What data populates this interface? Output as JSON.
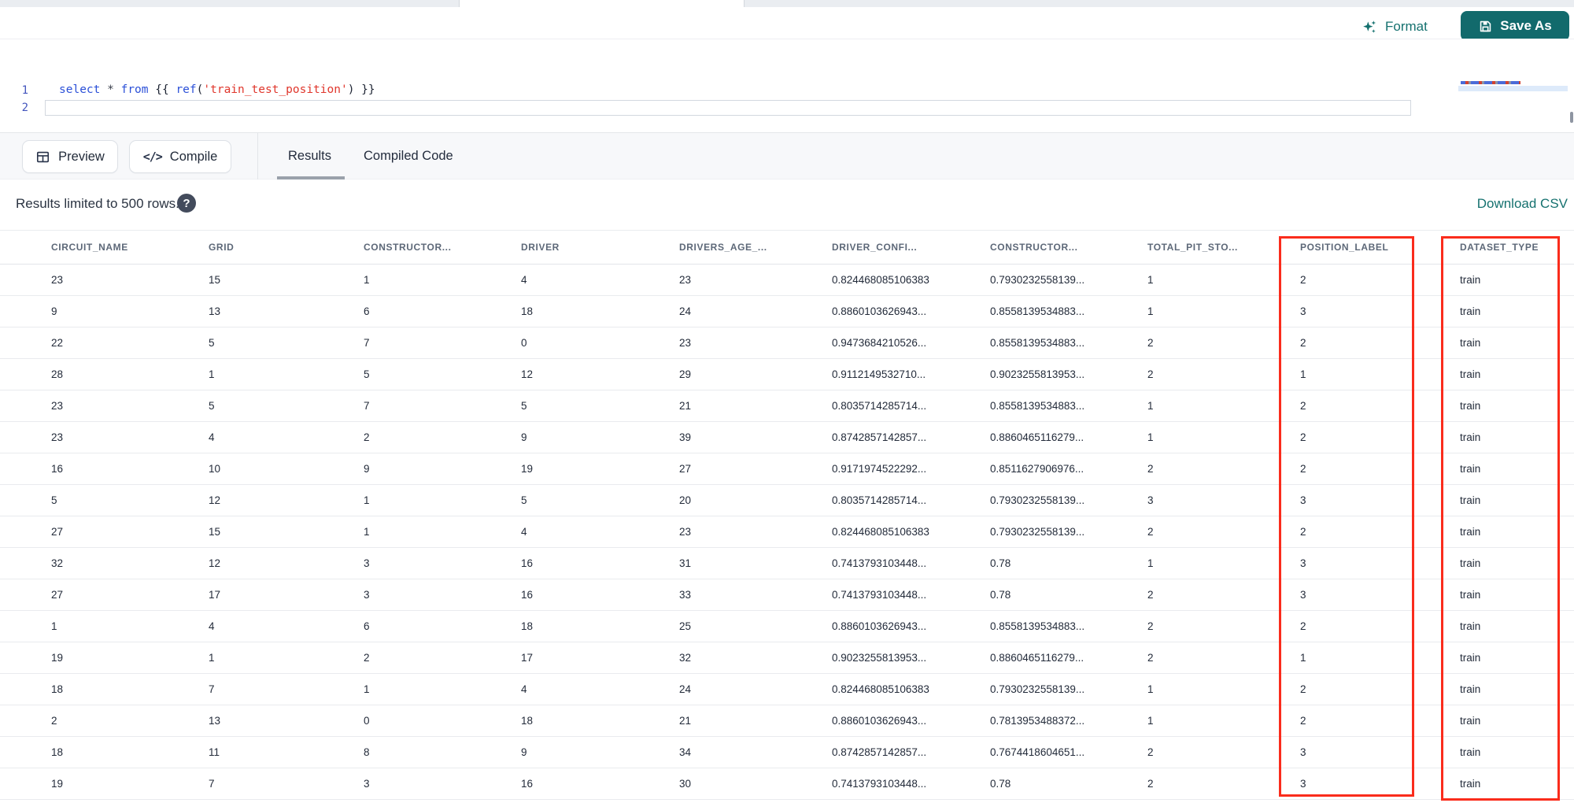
{
  "toolbar": {
    "format_label": "Format",
    "save_as_label": "Save As"
  },
  "editor": {
    "line1_number": "1",
    "line2_number": "2",
    "line1_tokens": [
      {
        "t": "select",
        "c": "kw"
      },
      {
        "t": " ",
        "c": "pl"
      },
      {
        "t": "*",
        "c": "op"
      },
      {
        "t": " ",
        "c": "pl"
      },
      {
        "t": "from",
        "c": "kw"
      },
      {
        "t": " {{ ",
        "c": "pl"
      },
      {
        "t": "ref",
        "c": "kw"
      },
      {
        "t": "(",
        "c": "pl"
      },
      {
        "t": "'train_test_position'",
        "c": "str"
      },
      {
        "t": ")",
        "c": "pl"
      },
      {
        "t": " }}",
        "c": "pl"
      }
    ]
  },
  "actions": {
    "preview_label": "Preview",
    "compile_label": "Compile",
    "compile_glyph": "</>"
  },
  "tabs": [
    {
      "label": "Results",
      "active": true
    },
    {
      "label": "Compiled Code",
      "active": false
    }
  ],
  "results": {
    "limit_note": "Results limited to 500 rows.",
    "help_glyph": "?",
    "download_label": "Download CSV"
  },
  "table": {
    "columns": [
      "CIRCUIT_NAME",
      "GRID",
      "CONSTRUCTOR...",
      "DRIVER",
      "DRIVERS_AGE_...",
      "DRIVER_CONFI...",
      "CONSTRUCTOR...",
      "TOTAL_PIT_STO...",
      "POSITION_LABEL",
      "DATASET_TYPE"
    ],
    "rows": [
      [
        "23",
        "15",
        "1",
        "4",
        "23",
        "0.824468085106383",
        "0.7930232558139...",
        "1",
        "2",
        "train"
      ],
      [
        "9",
        "13",
        "6",
        "18",
        "24",
        "0.8860103626943...",
        "0.8558139534883...",
        "1",
        "3",
        "train"
      ],
      [
        "22",
        "5",
        "7",
        "0",
        "23",
        "0.9473684210526...",
        "0.8558139534883...",
        "2",
        "2",
        "train"
      ],
      [
        "28",
        "1",
        "5",
        "12",
        "29",
        "0.9112149532710...",
        "0.9023255813953...",
        "2",
        "1",
        "train"
      ],
      [
        "23",
        "5",
        "7",
        "5",
        "21",
        "0.8035714285714...",
        "0.8558139534883...",
        "1",
        "2",
        "train"
      ],
      [
        "23",
        "4",
        "2",
        "9",
        "39",
        "0.8742857142857...",
        "0.8860465116279...",
        "1",
        "2",
        "train"
      ],
      [
        "16",
        "10",
        "9",
        "19",
        "27",
        "0.9171974522292...",
        "0.8511627906976...",
        "2",
        "2",
        "train"
      ],
      [
        "5",
        "12",
        "1",
        "5",
        "20",
        "0.8035714285714...",
        "0.7930232558139...",
        "3",
        "3",
        "train"
      ],
      [
        "27",
        "15",
        "1",
        "4",
        "23",
        "0.824468085106383",
        "0.7930232558139...",
        "2",
        "2",
        "train"
      ],
      [
        "32",
        "12",
        "3",
        "16",
        "31",
        "0.7413793103448...",
        "0.78",
        "1",
        "3",
        "train"
      ],
      [
        "27",
        "17",
        "3",
        "16",
        "33",
        "0.7413793103448...",
        "0.78",
        "2",
        "3",
        "train"
      ],
      [
        "1",
        "4",
        "6",
        "18",
        "25",
        "0.8860103626943...",
        "0.8558139534883...",
        "2",
        "2",
        "train"
      ],
      [
        "19",
        "1",
        "2",
        "17",
        "32",
        "0.9023255813953...",
        "0.8860465116279...",
        "2",
        "1",
        "train"
      ],
      [
        "18",
        "7",
        "1",
        "4",
        "24",
        "0.824468085106383",
        "0.7930232558139...",
        "1",
        "2",
        "train"
      ],
      [
        "2",
        "13",
        "0",
        "18",
        "21",
        "0.8860103626943...",
        "0.7813953488372...",
        "1",
        "2",
        "train"
      ],
      [
        "18",
        "11",
        "8",
        "9",
        "34",
        "0.8742857142857...",
        "0.7674418604651...",
        "2",
        "3",
        "train"
      ],
      [
        "19",
        "7",
        "3",
        "16",
        "30",
        "0.7413793103448...",
        "0.78",
        "2",
        "3",
        "train"
      ]
    ],
    "highlighted_columns": [
      "POSITION_LABEL",
      "DATASET_TYPE"
    ],
    "highlight_color": "#fa2c1c"
  },
  "colors": {
    "accent_text": "#15716F",
    "accent_button": "#126A6C",
    "keyword_blue": "#2b50d8",
    "string_red": "#e0362c"
  }
}
